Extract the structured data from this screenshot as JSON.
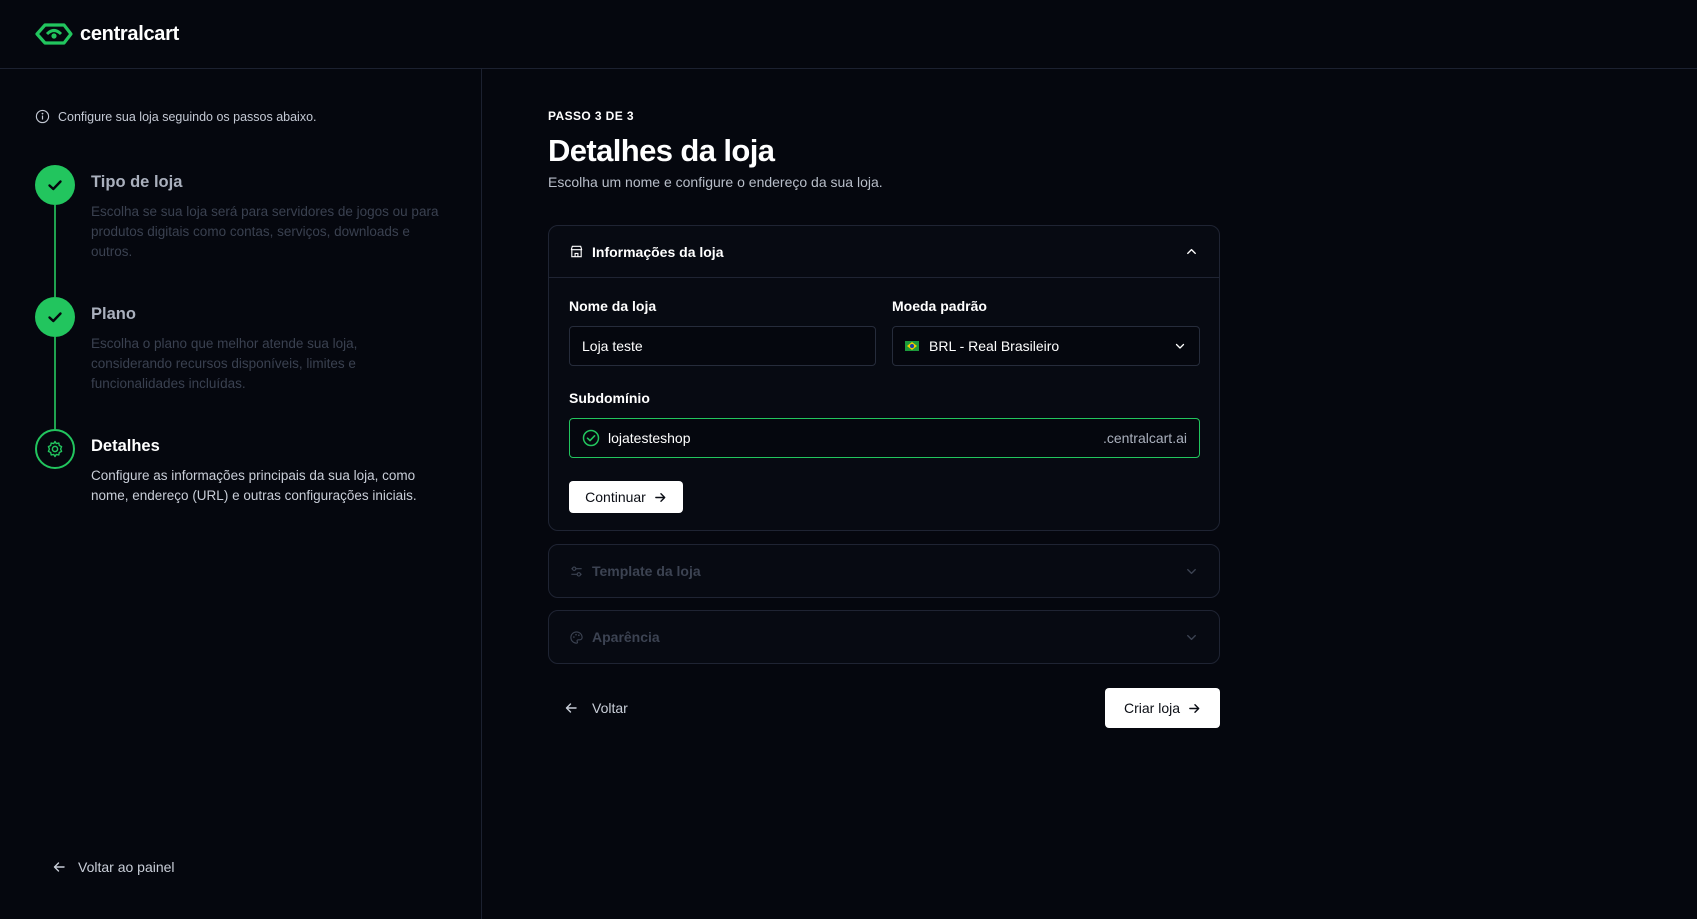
{
  "header": {
    "brand_name": "centralcart",
    "brand_color": "#22c55e"
  },
  "sidebar": {
    "hint": "Configure sua loja seguindo os passos abaixo.",
    "steps": [
      {
        "title": "Tipo de loja",
        "description": "Escolha se sua loja será para servidores de jogos ou para produtos digitais como contas, serviços, downloads e outros.",
        "status": "done"
      },
      {
        "title": "Plano",
        "description": "Escolha o plano que melhor atende sua loja, considerando recursos disponíveis, limites e funcionalidades incluídas.",
        "status": "done"
      },
      {
        "title": "Detalhes",
        "description": "Configure as informações principais da sua loja, como nome, endereço (URL) e outras configurações iniciais.",
        "status": "current"
      }
    ],
    "back_label": "Voltar ao painel"
  },
  "main": {
    "step_label": "PASSO 3 DE 3",
    "title": "Detalhes da loja",
    "subtitle": "Escolha um nome e configure o endereço da sua loja.",
    "info_card": {
      "title": "Informações da loja",
      "store_name_label": "Nome da loja",
      "store_name_value": "Loja teste",
      "currency_label": "Moeda padrão",
      "currency_value": "BRL - Real Brasileiro",
      "subdomain_label": "Subdomínio",
      "subdomain_value": "lojatesteshop",
      "subdomain_suffix": ".centralcart.ai",
      "continue_label": "Continuar"
    },
    "template_card": {
      "title": "Template da loja"
    },
    "appearance_card": {
      "title": "Aparência"
    },
    "back_label": "Voltar",
    "create_label": "Criar loja"
  }
}
